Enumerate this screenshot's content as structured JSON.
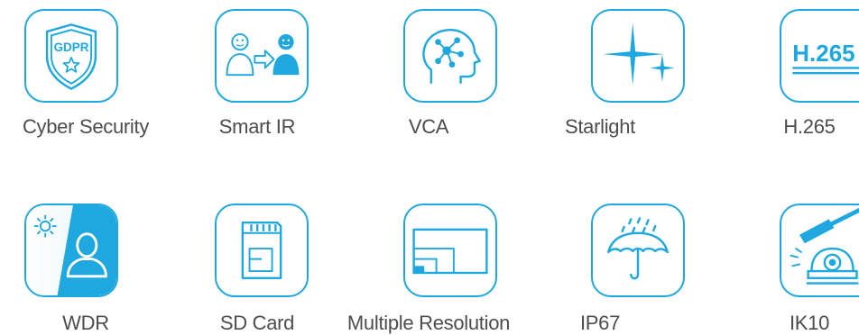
{
  "accent_color": "#1fa8df",
  "label_color": "#4d4d4d",
  "features": [
    {
      "label": "Cyber Security",
      "icon": "gdpr-shield-icon",
      "badge_text": "GDPR"
    },
    {
      "label": "Smart IR",
      "icon": "smart-ir-icon"
    },
    {
      "label": "VCA",
      "icon": "vca-head-icon"
    },
    {
      "label": "Starlight",
      "icon": "starlight-icon"
    },
    {
      "label": "H.265",
      "icon": "h265-icon",
      "badge_text": "H.265"
    },
    {
      "label": "WDR",
      "icon": "wdr-icon"
    },
    {
      "label": "SD Card",
      "icon": "sd-card-icon"
    },
    {
      "label": "Multiple Resolution",
      "icon": "multiple-resolution-icon"
    },
    {
      "label": "IP67",
      "icon": "umbrella-rain-icon"
    },
    {
      "label": "IK10",
      "icon": "hammer-dome-icon"
    }
  ]
}
